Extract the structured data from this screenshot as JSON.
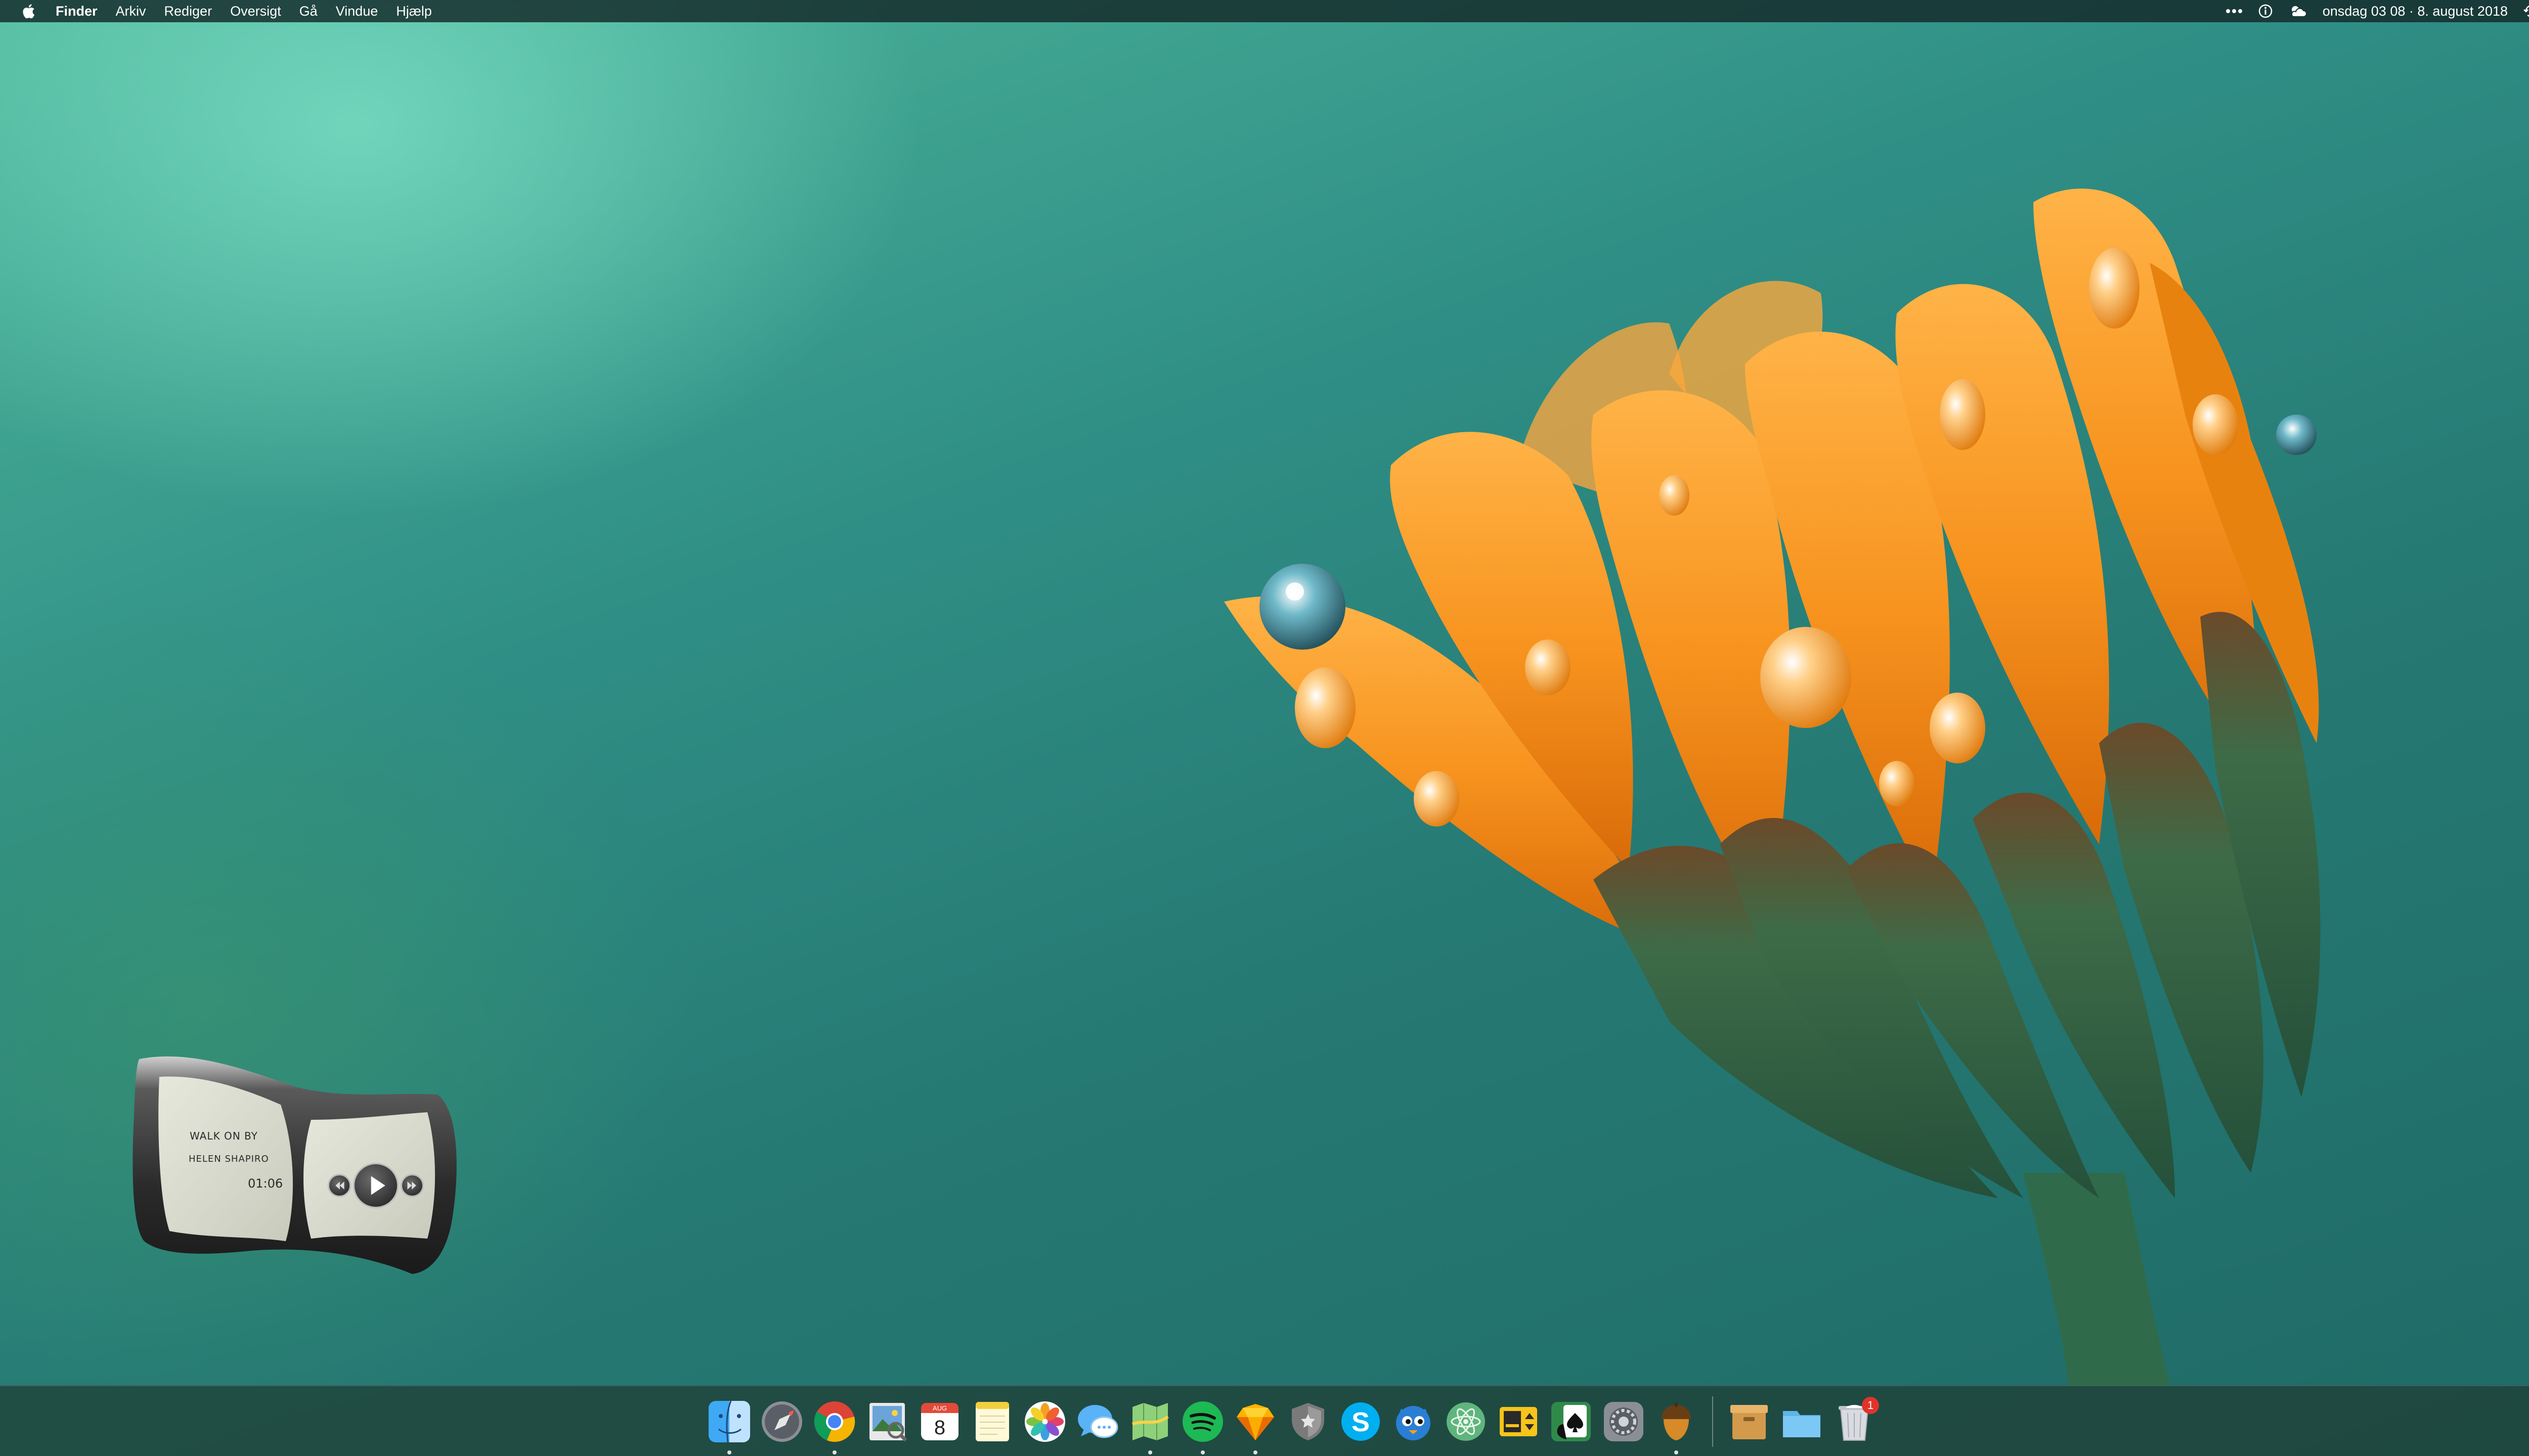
{
  "menubar": {
    "apple_icon": "apple-logo-icon",
    "app_name": "Finder",
    "menus": [
      "Arkiv",
      "Rediger",
      "Oversigt",
      "Gå",
      "Vindue",
      "Hjælp"
    ],
    "clock": "onsdag 03 08 · 8. august 2018"
  },
  "widget": {
    "song": "WALK ON BY",
    "artist": "HELEN SHAPIRO",
    "time": "01:06"
  },
  "dock": {
    "apps": [
      {
        "icon": "finder-icon",
        "running": true
      },
      {
        "icon": "launchpad-icon",
        "running": false
      },
      {
        "icon": "chrome-icon",
        "running": true
      },
      {
        "icon": "preview-icon",
        "running": false
      },
      {
        "icon": "calendar-icon",
        "running": false,
        "calendar_month": "AUG",
        "calendar_day": "8"
      },
      {
        "icon": "notes-icon",
        "running": false
      },
      {
        "icon": "photos-icon",
        "running": false
      },
      {
        "icon": "messages-icon",
        "running": false
      },
      {
        "icon": "maps-icon",
        "running": true
      },
      {
        "icon": "spotify-icon",
        "running": true
      },
      {
        "icon": "sketch-icon",
        "running": true
      },
      {
        "icon": "security-shield-icon",
        "running": false
      },
      {
        "icon": "skype-icon",
        "running": false
      },
      {
        "icon": "tweetbot-icon",
        "running": false
      },
      {
        "icon": "atom-icon",
        "running": false
      },
      {
        "icon": "transmit-icon",
        "running": false
      },
      {
        "icon": "solitaire-icon",
        "running": false
      },
      {
        "icon": "system-preferences-icon",
        "running": false
      },
      {
        "icon": "acorn-icon",
        "running": true
      }
    ],
    "others": [
      {
        "icon": "archive-box-icon"
      },
      {
        "icon": "folder-icon"
      },
      {
        "icon": "trash-icon",
        "badge": "1"
      }
    ]
  },
  "colors": {
    "wallpaper_teal": "#2f8f86",
    "wallpaper_light": "#7fd8c0",
    "flower_orange": "#f7931e",
    "sepal_green": "#3a6b45"
  }
}
